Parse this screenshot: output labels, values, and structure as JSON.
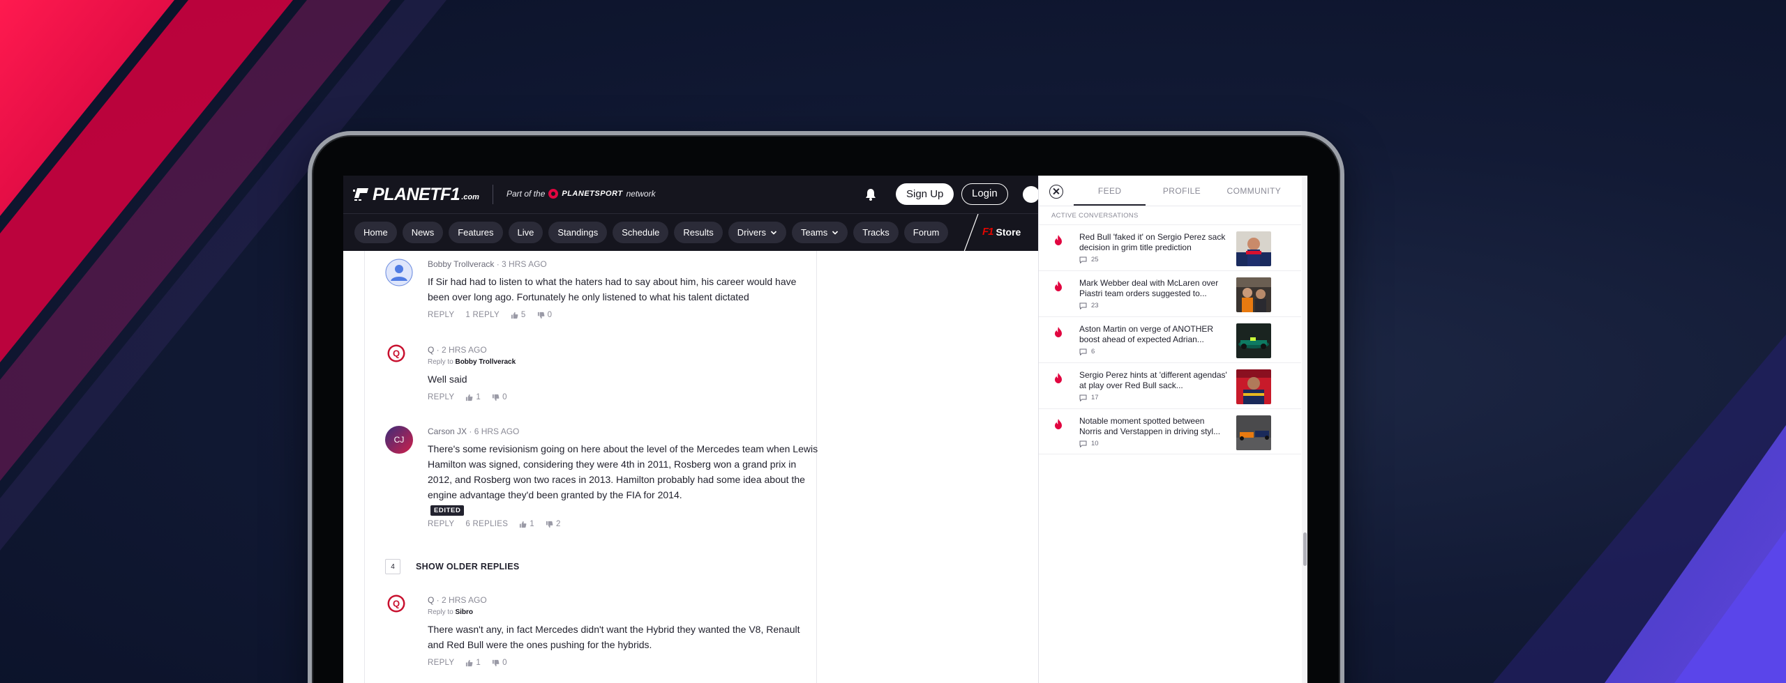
{
  "brand": {
    "logo_text": "PLANETF1",
    "logo_suffix": ".com",
    "network_prefix": "Part of the",
    "network_name": "PLANETSPORT",
    "network_suffix": "network",
    "accent": "#e10640"
  },
  "header": {
    "signup_label": "Sign Up",
    "login_label": "Login"
  },
  "nav": {
    "items": [
      {
        "label": "Home"
      },
      {
        "label": "News"
      },
      {
        "label": "Features"
      },
      {
        "label": "Live"
      },
      {
        "label": "Standings"
      },
      {
        "label": "Schedule"
      },
      {
        "label": "Results"
      },
      {
        "label": "Drivers",
        "dropdown": true
      },
      {
        "label": "Teams",
        "dropdown": true
      },
      {
        "label": "Tracks"
      },
      {
        "label": "Forum"
      }
    ],
    "store_brand": "F1",
    "store_label": "Store"
  },
  "comments": [
    {
      "author": "Bobby Trollverack",
      "time": "3 HRS AGO",
      "text": "If Sir had had to listen to what the haters had to say about him, his career would have been over long ago. Fortunately he only listened to what his talent dictated",
      "reply_label": "REPLY",
      "replies_label": "1 REPLY",
      "likes": "5",
      "dislikes": "0"
    },
    {
      "author": "Q",
      "time": "2 HRS AGO",
      "reply_to_prefix": "Reply to",
      "reply_to": "Bobby Trollverack",
      "text": "Well said",
      "reply_label": "REPLY",
      "likes": "1",
      "dislikes": "0"
    },
    {
      "author": "Carson JX",
      "initials": "CJ",
      "time": "6 HRS AGO",
      "text": "There's some revisionism going on here about the level of the Mercedes team when Lewis Hamilton was signed, considering they were 4th in 2011, Rosberg won a grand prix in 2012, and Rosberg won two races in 2013. Hamilton probably had some idea about the engine advantage they'd been granted by the FIA for 2014.",
      "edited_label": "EDITED",
      "reply_label": "REPLY",
      "replies_label": "6 REPLIES",
      "likes": "1",
      "dislikes": "2"
    },
    {
      "author": "Q",
      "time": "2 HRS AGO",
      "reply_to_prefix": "Reply to",
      "reply_to": "Sibro",
      "text": "There wasn't any, in fact Mercedes didn't want the Hybrid they wanted the V8, Renault and Red Bull were the ones pushing for the hybrids.",
      "reply_label": "REPLY",
      "likes": "1",
      "dislikes": "0"
    }
  ],
  "older_replies": {
    "count": "4",
    "label": "SHOW OLDER REPLIES"
  },
  "panel": {
    "tabs": [
      {
        "label": "FEED",
        "active": true
      },
      {
        "label": "PROFILE"
      },
      {
        "label": "COMMUNITY"
      }
    ],
    "section_title": "ACTIVE CONVERSATIONS",
    "conversations": [
      {
        "title": "Red Bull 'faked it' on Sergio Perez sack decision in grim title prediction",
        "count": "25"
      },
      {
        "title": "Mark Webber deal with McLaren over Piastri team orders suggested to...",
        "count": "23"
      },
      {
        "title": "Aston Martin on verge of ANOTHER boost ahead of expected Adrian...",
        "count": "6"
      },
      {
        "title": "Sergio Perez hints at 'different agendas' at play over Red Bull sack...",
        "count": "17"
      },
      {
        "title": "Notable moment spotted between Norris and Verstappen in driving styl...",
        "count": "10"
      }
    ]
  }
}
